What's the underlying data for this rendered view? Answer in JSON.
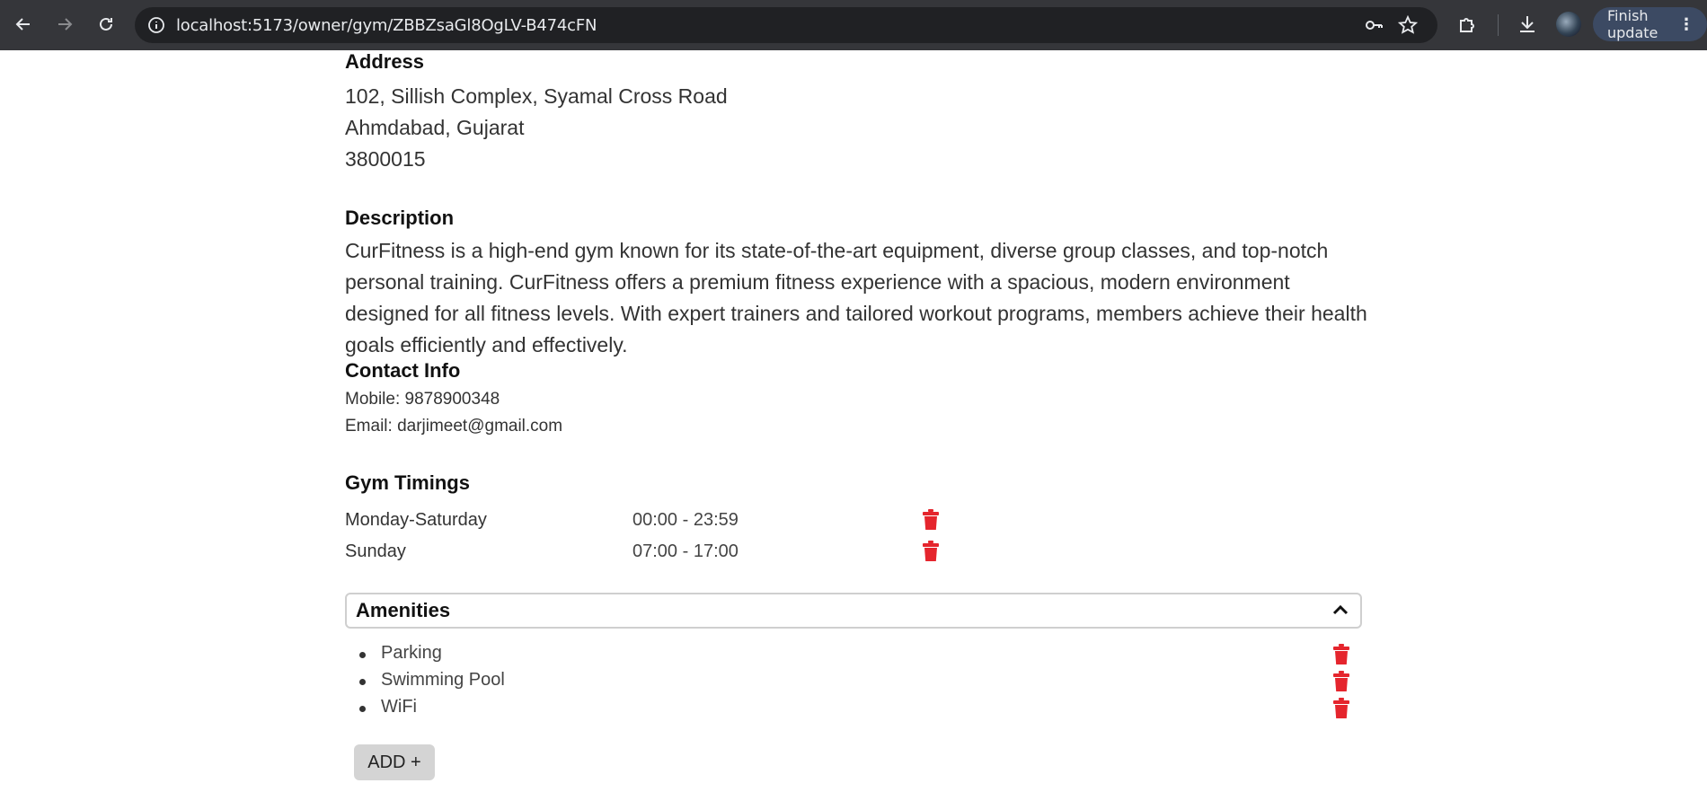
{
  "browser": {
    "url": "localhost:5173/owner/gym/ZBBZsaGl8OgLV-B474cFN",
    "finish_update_label": "Finish update",
    "menu_label": "⋮"
  },
  "address": {
    "heading": "Address",
    "line1": "102, Sillish Complex, Syamal Cross Road",
    "line2": "Ahmdabad, Gujarat",
    "line3": "3800015"
  },
  "description": {
    "heading": "Description",
    "text": "CurFitness is a high-end gym known for its state-of-the-art equipment, diverse group classes, and top-notch personal training. CurFitness offers a premium fitness experience with a spacious, modern environment designed for all fitness levels. With expert trainers and tailored workout programs, members achieve their health goals efficiently and effectively."
  },
  "contact": {
    "heading": "Contact Info",
    "mobile": "Mobile: 9878900348",
    "email": "Email: darjimeet@gmail.com"
  },
  "timings": {
    "heading": "Gym Timings",
    "rows": [
      {
        "days": "Monday-Saturday",
        "hours": "00:00 - 23:59"
      },
      {
        "days": "Sunday",
        "hours": "07:00 - 17:00"
      }
    ]
  },
  "amenities": {
    "heading": "Amenities",
    "items": [
      "Parking",
      "Swimming Pool",
      "WiFi"
    ],
    "add_label": "ADD +"
  },
  "colors": {
    "delete_icon": "#e5252d",
    "chrome_bg": "#35363a"
  },
  "icons": {
    "back": "arrow-left-icon",
    "forward": "arrow-right-icon",
    "reload": "reload-icon",
    "site_info": "info-icon",
    "password_key": "key-icon",
    "bookmark": "star-icon",
    "extensions": "puzzle-icon",
    "download": "download-icon",
    "delete": "trash-icon",
    "collapse": "chevron-up-icon"
  }
}
